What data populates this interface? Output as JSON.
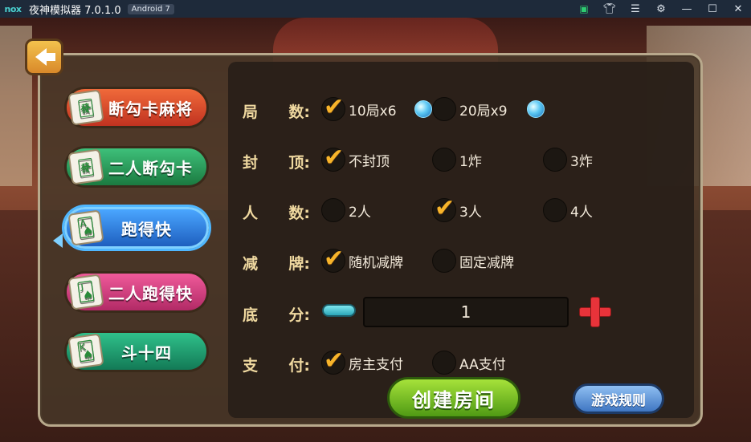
{
  "titlebar": {
    "logo": "nox",
    "title": "夜神模拟器 7.0.1.0",
    "badge": "Android 7",
    "icons": [
      "store-icon",
      "shirt-icon",
      "menu-icon",
      "settings-icon",
      "minimize-icon",
      "maximize-icon",
      "close-icon"
    ]
  },
  "menu": {
    "items": [
      {
        "label": "断勾卡麻将",
        "icon": "mahjong-tile-icon",
        "color": "#e04a2a",
        "selected": false
      },
      {
        "label": "二人断勾卡",
        "icon": "mahjong-tile-icon",
        "color": "#2aa060",
        "selected": false
      },
      {
        "label": "跑得快",
        "icon": "playing-cards-icon",
        "color": "#3a8ae8",
        "selected": true
      },
      {
        "label": "二人跑得快",
        "icon": "playing-cards-icon",
        "color": "#d2407e",
        "selected": false
      },
      {
        "label": "斗十四",
        "icon": "playing-cards-icon",
        "color": "#22a070",
        "selected": false
      }
    ]
  },
  "settings": {
    "rounds": {
      "label_a": "局",
      "label_b": "数:",
      "options": [
        "10局x6",
        "20局x9"
      ],
      "selected": 0
    },
    "cap": {
      "label_a": "封",
      "label_b": "顶:",
      "options": [
        "不封顶",
        "1炸",
        "3炸"
      ],
      "selected": 0
    },
    "players": {
      "label_a": "人",
      "label_b": "数:",
      "options": [
        "2人",
        "3人",
        "4人"
      ],
      "selected": 1
    },
    "cards": {
      "label_a": "减",
      "label_b": "牌:",
      "options": [
        "随机减牌",
        "固定减牌"
      ],
      "selected": 0
    },
    "base_score": {
      "label_a": "底",
      "label_b": "分:",
      "value": "1"
    },
    "payment": {
      "label_a": "支",
      "label_b": "付:",
      "options": [
        "房主支付",
        "AA支付"
      ],
      "selected": 0
    }
  },
  "buttons": {
    "create": "创建房间",
    "rules": "游戏规则"
  },
  "colors": {
    "accent_check": "#f7b42a",
    "label": "#f0d9a0",
    "panel": "#281e18"
  }
}
